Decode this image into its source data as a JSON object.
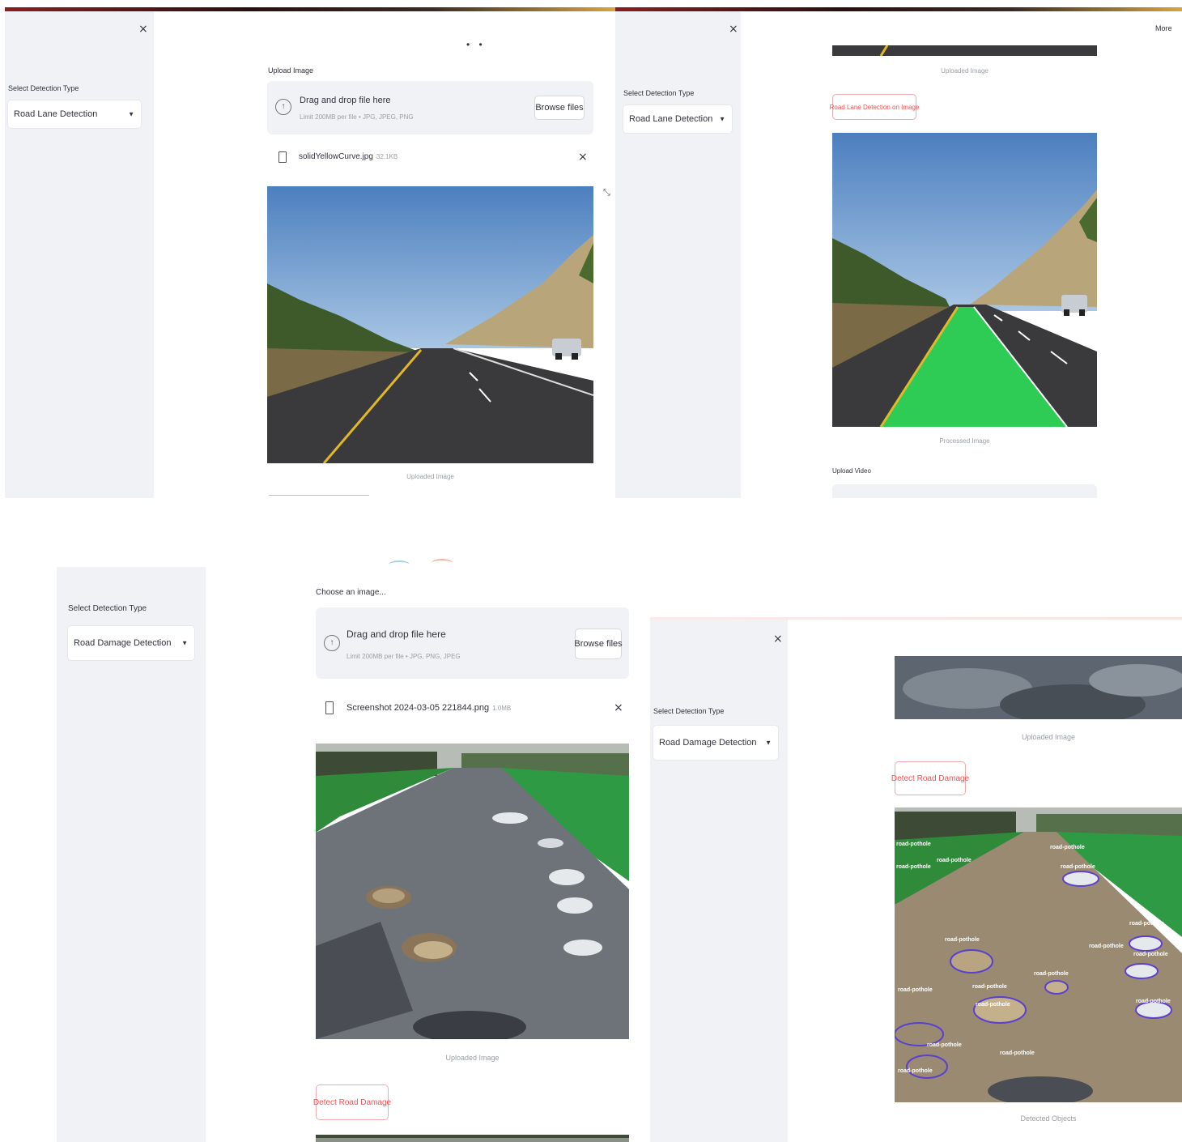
{
  "panel1": {
    "sidebar": {
      "close_icon": "×",
      "select_label": "Select Detection Type",
      "select_value": "Road Lane Detection"
    },
    "main": {
      "status_dots": "• •",
      "upload_label": "Upload Image",
      "dropzone_title": "Drag and drop file here",
      "dropzone_sub": "Limit 200MB per file • JPG, JPEG, PNG",
      "browse_button": "Browse files",
      "file_name": "solidYellowCurve.jpg",
      "file_size": "32.1KB",
      "file_remove": "×",
      "expand_icon": "⤡",
      "image_caption": "Uploaded Image"
    }
  },
  "panel2": {
    "sidebar": {
      "close_icon": "×",
      "select_label": "Select Detection Type",
      "select_value": "Road Lane Detection"
    },
    "main": {
      "menu_label": "More",
      "uploaded_caption": "Uploaded Image",
      "detect_button": "Road Lane Detection on Image",
      "processed_caption": "Processed Image",
      "upload_videos_label": "Upload Video"
    }
  },
  "panel3": {
    "sidebar": {
      "select_label": "Select Detection Type",
      "select_value": "Road Damage Detection"
    },
    "main": {
      "choose_label": "Choose an image...",
      "dropzone_title": "Drag and drop file here",
      "dropzone_sub": "Limit 200MB per file • JPG, PNG, JPEG",
      "browse_button": "Browse files",
      "file_name": "Screenshot 2024-03-05 221844.png",
      "file_size": "1.0MB",
      "file_remove": "×",
      "image_caption": "Uploaded Image",
      "detect_button": "Detect Road Damage"
    }
  },
  "panel4": {
    "sidebar": {
      "close_icon": "×",
      "select_label": "Select Detection Type",
      "select_value": "Road Damage Detection"
    },
    "main": {
      "uploaded_caption": "Uploaded Image",
      "detect_button": "Detect Road Damage",
      "detected_caption": "Detected Objects",
      "detection_label": "road-pothole"
    }
  },
  "colors": {
    "sidebar_bg": "#f0f2f6",
    "accent_red": "#ff4b4b",
    "lane_green": "#2ecc55",
    "detection_box": "#5b3fd1"
  }
}
